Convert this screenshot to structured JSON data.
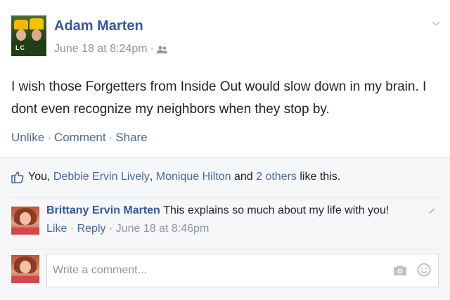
{
  "post": {
    "author": "Adam Marten",
    "timestamp": "June 18 at 8:24pm",
    "separator": "·",
    "audience_icon": "friends-icon",
    "text": "I wish those Forgetters from Inside Out would slow down in my brain. I dont even recognize my neighbors when they stop by.",
    "avatar_logo": "LC"
  },
  "actions": {
    "unlike": "Unlike",
    "comment": "Comment",
    "share": "Share",
    "sep": "·"
  },
  "likes": {
    "you": "You,",
    "person1": "Debbie Ervin Lively",
    "comma": ",",
    "person2": "Monique Hilton",
    "and": "and",
    "others": "2 others",
    "suffix": "like this."
  },
  "comment": {
    "author": "Brittany Ervin Marten",
    "text": "This explains so much about my life with you!",
    "like": "Like",
    "reply": "Reply",
    "timestamp": "June 18 at 8:46pm",
    "sep": "·"
  },
  "composer": {
    "placeholder": "Write a comment..."
  },
  "colors": {
    "link": "#365899",
    "action": "#4b67a1",
    "muted": "#90949c",
    "feedback_bg": "#f6f7f9"
  }
}
